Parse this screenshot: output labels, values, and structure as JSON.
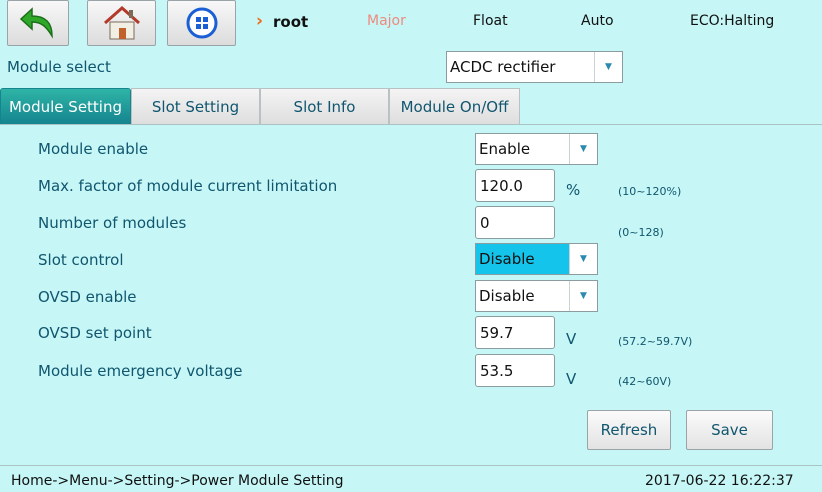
{
  "topbar": {
    "root_label": "root",
    "alarm_level": "Major",
    "charge_mode": "Float",
    "control_mode": "Auto",
    "eco_status": "ECO:Halting"
  },
  "module_select": {
    "label": "Module select",
    "value": "ACDC rectifier"
  },
  "tabs": [
    {
      "label": "Module Setting",
      "active": true
    },
    {
      "label": "Slot Setting",
      "active": false
    },
    {
      "label": "Slot Info",
      "active": false
    },
    {
      "label": "Module On/Off",
      "active": false
    }
  ],
  "settings": {
    "module_enable": {
      "label": "Module enable",
      "value": "Enable"
    },
    "current_limit": {
      "label": "Max. factor of module current limitation",
      "value": "120.0",
      "unit": "%",
      "range": "(10~120%)"
    },
    "num_modules": {
      "label": "Number of modules",
      "value": "0",
      "range": "(0~128)"
    },
    "slot_control": {
      "label": "Slot control",
      "value": "Disable"
    },
    "ovsd_enable": {
      "label": "OVSD enable",
      "value": "Disable"
    },
    "ovsd_setpoint": {
      "label": "OVSD set point",
      "value": "59.7",
      "unit": "V",
      "range": "(57.2~59.7V)"
    },
    "emergency_voltage": {
      "label": "Module emergency voltage",
      "value": "53.5",
      "unit": "V",
      "range": "(42~60V)"
    }
  },
  "actions": {
    "refresh": "Refresh",
    "save": "Save"
  },
  "footer": {
    "breadcrumb": "Home->Menu->Setting->Power Module Setting",
    "datetime": "2017-06-22 16:22:37"
  },
  "colors": {
    "background": "#c6f6f6",
    "active_tab": "#15848f",
    "highlight": "#14c4ea",
    "text": "#10566e",
    "alarm": "#ee8a80",
    "accent": "#ee6a1a"
  }
}
